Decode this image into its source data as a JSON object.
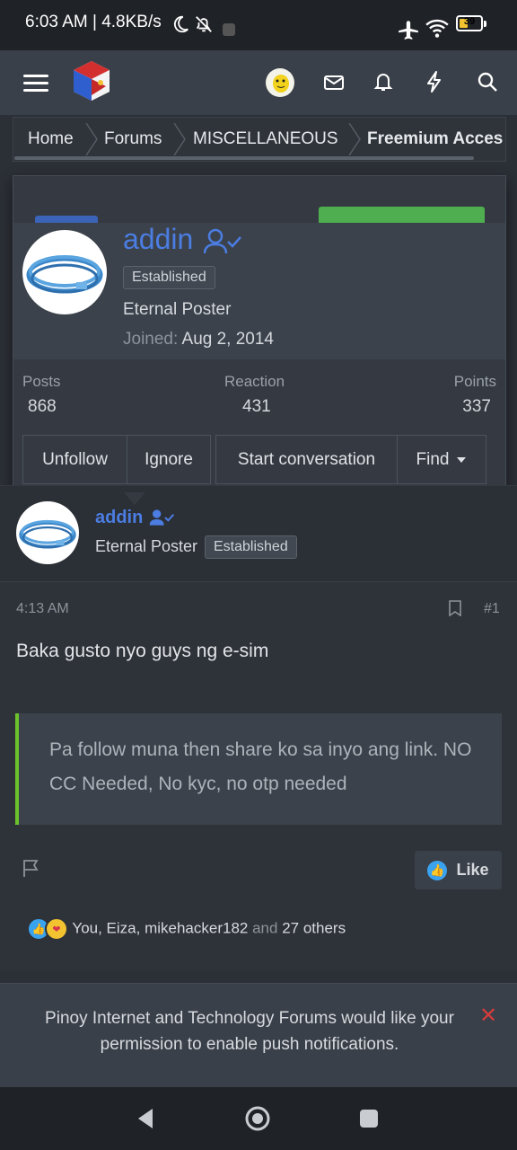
{
  "status_bar": {
    "time": "6:03 AM | 4.8KB/s",
    "battery": "39",
    "battery_level": 0.39
  },
  "header": {
    "icons": [
      "menu-icon",
      "site-logo",
      "user-avatar",
      "mail-icon",
      "bell-icon",
      "lightning-icon",
      "search-icon"
    ]
  },
  "breadcrumb": {
    "items": [
      "Home",
      "Forums",
      "MISCELLANEOUS",
      "Freemium Acces"
    ]
  },
  "profile_popup": {
    "username": "addin",
    "badge": "Established",
    "title": "Eternal Poster",
    "joined_label": "Joined:",
    "joined_date": "Aug 2, 2014",
    "stats": [
      {
        "label": "Posts",
        "value": "868"
      },
      {
        "label": "Reaction",
        "value": "431"
      },
      {
        "label": "Points",
        "value": "337"
      }
    ],
    "buttons": {
      "unfollow": "Unfollow",
      "ignore": "Ignore",
      "start_conversation": "Start conversation",
      "find": "Find"
    }
  },
  "post": {
    "username": "addin",
    "user_title": "Eternal Poster",
    "badge": "Established",
    "time": "4:13 AM",
    "number": "#1",
    "text": "Baka gusto nyo guys ng e-sim",
    "quote": "Pa follow muna then share ko sa inyo ang link. NO CC Needed, No kyc, no otp needed",
    "like_label": "Like",
    "reactions": {
      "names": "You, Eiza, mikehacker182",
      "and": "and",
      "others": "27 others"
    }
  },
  "push_notice": {
    "text": "Pinoy Internet and Technology Forums would like your permission to enable push notifications."
  },
  "colors": {
    "accent_blue": "#4b7de2",
    "quote_bar": "#6cc22c",
    "close_red": "#d33c3c"
  }
}
